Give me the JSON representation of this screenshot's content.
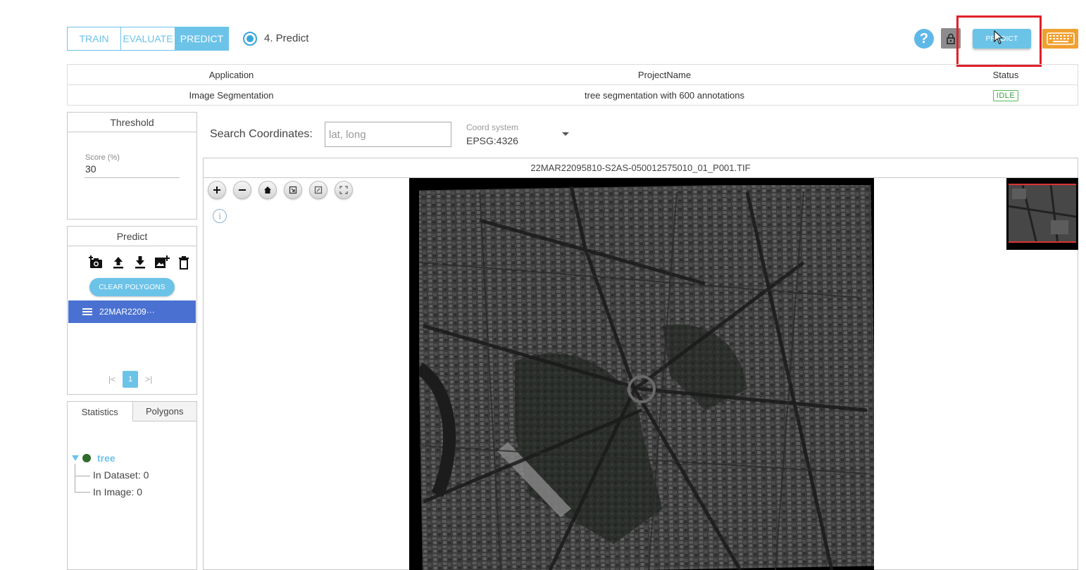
{
  "mode_tabs": [
    {
      "label": "TRAIN",
      "active": false
    },
    {
      "label": "EVALUATE",
      "active": false
    },
    {
      "label": "PREDICT",
      "active": true
    }
  ],
  "step": {
    "label": "4. Predict"
  },
  "header_actions": {
    "help": "?",
    "predict_label": "PREDICT"
  },
  "info_table": {
    "headers": {
      "application": "Application",
      "project": "ProjectName",
      "status": "Status"
    },
    "row": {
      "application": "Image Segmentation",
      "project": "tree segmentation with 600 annotations",
      "status": "IDLE"
    }
  },
  "threshold": {
    "title": "Threshold",
    "score_label": "Score (%)",
    "score_value": "30"
  },
  "predict_panel": {
    "title": "Predict",
    "icons": [
      "add-photo-icon",
      "upload-icon",
      "download-icon",
      "add-image-icon",
      "delete-icon"
    ],
    "clear_label": "CLEAR POLYGONS",
    "file_item": "22MAR2209···",
    "page": "1"
  },
  "statistics": {
    "tabs": [
      "Statistics",
      "Polygons"
    ],
    "class_name": "tree",
    "class_color": "#2f6b2a",
    "in_dataset": "In Dataset: 0",
    "in_image": "In Image: 0"
  },
  "search": {
    "label": "Search Coordinates:",
    "placeholder": "lat, long",
    "coord_label": "Coord system",
    "coord_value": "EPSG:4326"
  },
  "viewer": {
    "filename": "22MAR22095810-S2AS-050012575010_01_P001.TIF",
    "tools": [
      "zoom-in-icon",
      "zoom-out-icon",
      "home-icon",
      "rotate-icon",
      "fit-icon",
      "fullscreen-icon"
    ],
    "info": "i"
  },
  "colors": {
    "accent": "#6cc3e8",
    "selected_row": "#4a71d2",
    "status_idle": "#58b85a",
    "keyboard": "#f0a030",
    "highlight": "#e0202a"
  }
}
